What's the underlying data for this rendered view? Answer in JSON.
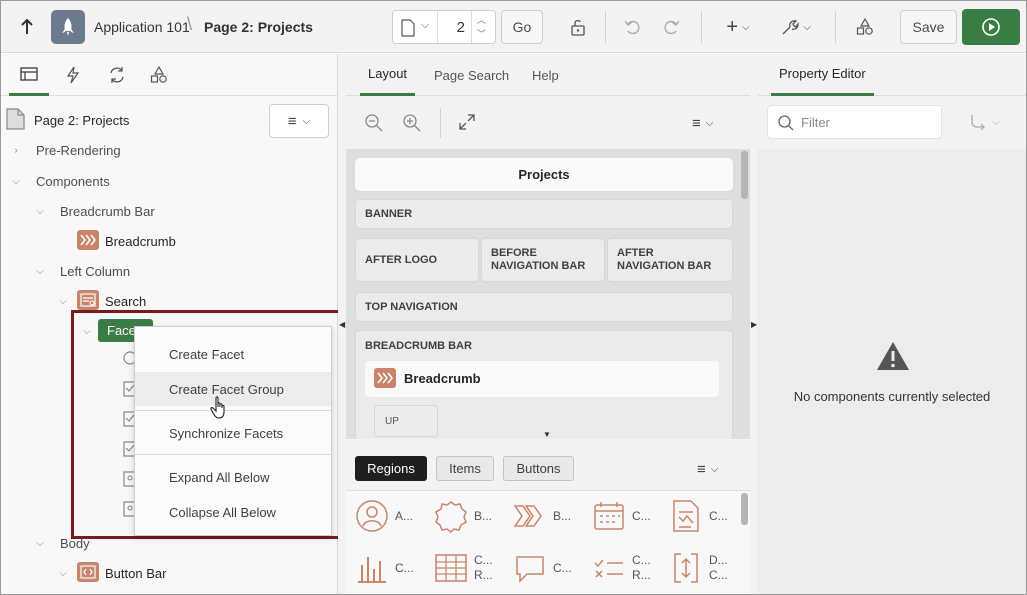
{
  "topbar": {
    "app_name": "Application 101",
    "page_name": "Page 2: Projects",
    "page_number": "2",
    "go_label": "Go",
    "save_label": "Save",
    "accent": "#3a7d44"
  },
  "left": {
    "page_label": "Page 2: Projects",
    "tree": {
      "pre_rendering": "Pre-Rendering",
      "components": "Components",
      "breadcrumb_bar": "Breadcrumb Bar",
      "breadcrumb": "Breadcrumb",
      "left_column": "Left Column",
      "search": "Search",
      "facets": "Facets",
      "body": "Body",
      "button_bar": "Button Bar"
    }
  },
  "context_menu": {
    "items": [
      "Create Facet",
      "Create Facet Group",
      "Synchronize Facets",
      "Expand All Below",
      "Collapse All Below"
    ]
  },
  "middle": {
    "tabs": [
      "Layout",
      "Page Search",
      "Help"
    ],
    "canvas_title": "Projects",
    "regions": {
      "banner": "BANNER",
      "after_logo": "AFTER LOGO",
      "before_nav": "BEFORE NAVIGATION BAR",
      "after_nav": "AFTER NAVIGATION BAR",
      "top_nav": "TOP NAVIGATION",
      "breadcrumb_bar": "BREADCRUMB BAR",
      "breadcrumb": "Breadcrumb",
      "up": "UP"
    },
    "gallery_tabs": [
      "Regions",
      "Items",
      "Buttons"
    ],
    "gallery_row1": [
      "A...",
      "B...",
      "B...",
      "C...",
      "C..."
    ],
    "gallery_row2_top": [
      "",
      "C...",
      "",
      "C...",
      "D..."
    ],
    "gallery_row2_bottom": [
      "C...",
      "R...",
      "C...",
      "R...",
      "C..."
    ]
  },
  "right": {
    "tab": "Property Editor",
    "filter_placeholder": "Filter",
    "empty_message": "No components currently selected"
  },
  "colors": {
    "component_icon": "#c8856b",
    "selected_node": "#3a7d44",
    "menu_border": "#7a1b1b"
  }
}
